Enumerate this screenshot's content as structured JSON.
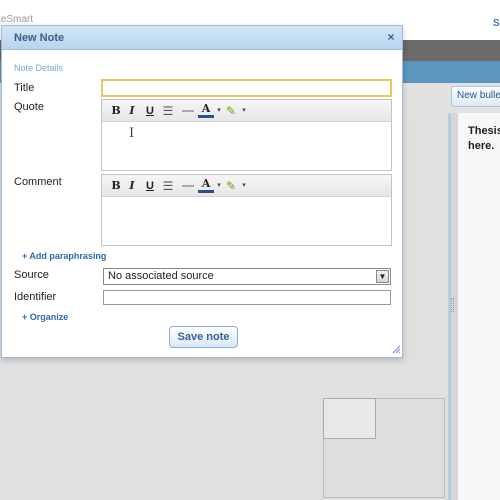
{
  "app": {
    "logo_text": "teSmart",
    "top_link": "S",
    "new_bullet_button": "New bulle",
    "thesis_text": "Thesis\nhere."
  },
  "dialog": {
    "title": "New Note",
    "close_icon": "×",
    "section_label": "Note Details",
    "fields": {
      "title_label": "Title",
      "title_value": "",
      "quote_label": "Quote",
      "comment_label": "Comment",
      "source_label": "Source",
      "source_selected": "No associated source",
      "identifier_label": "Identifier",
      "identifier_value": ""
    },
    "toolbar": {
      "bold": "B",
      "italic": "I",
      "underline": "U",
      "list": "☰",
      "font_color": "A",
      "dropdown_arrow": "▾",
      "highlight": "✎"
    },
    "cursor_glyph": "I",
    "add_paraphrasing": "+ Add paraphrasing",
    "organize": "+ Organize",
    "save_button": "Save note",
    "select_arrow": "▼"
  },
  "icons": {
    "close": "close-icon",
    "bold": "bold-icon",
    "italic": "italic-icon",
    "underline": "underline-icon",
    "list": "bullet-list-icon",
    "hr": "horizontal-rule-icon",
    "font_color": "font-color-icon",
    "highlight": "highlight-color-icon",
    "resize": "resize-grip-icon"
  },
  "colors": {
    "dialog_header": "#c6dcf1",
    "title_text": "#34618c",
    "link": "#2d6aa6",
    "focus_border": "#e7c86a",
    "app_blue_bar": "#5d96bd"
  }
}
